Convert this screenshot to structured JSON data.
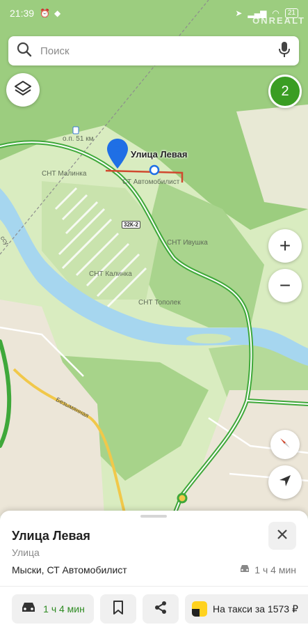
{
  "status_bar": {
    "time": "21:39",
    "battery": "21",
    "watermark": "ONREALT"
  },
  "search": {
    "placeholder": "Поиск",
    "icon": "search-icon",
    "voice_icon": "microphone-icon"
  },
  "map_controls": {
    "layers_icon": "layers-icon",
    "badge_count": "2",
    "zoom_in": "+",
    "zoom_out": "−",
    "compass_icon": "compass-icon",
    "location_icon": "navigation-arrow-icon"
  },
  "map": {
    "selected_place": "Улица Левая",
    "labels": {
      "stop": "о.п. 51 км",
      "snt_malinka": "СНТ Малинка",
      "st_avtomobilist": "СТ Автомобилист",
      "snt_ivushka": "СНТ Ивушка",
      "snt_kalinka": "СНТ Калинка",
      "snt_topolek": "СНТ Тополек",
      "road_badge": "32К-2",
      "street_bezymyannaya": "Безымянная",
      "river_label": "ссу"
    }
  },
  "sheet": {
    "title": "Улица Левая",
    "subtitle": "Улица",
    "address": "Мыски, СТ Автомобилист",
    "eta": "1 ч 4 мин",
    "actions": {
      "route_label": "1 ч 4 мин",
      "taxi_label": "На такси за 1573 ₽"
    }
  },
  "colors": {
    "accent_green": "#3a9d23",
    "route_green": "#3fa83a",
    "street_red": "#d0492f",
    "river": "#a6d6ef",
    "pin_blue": "#1f6fe5",
    "taxi_yellow": "#ffd21f"
  }
}
